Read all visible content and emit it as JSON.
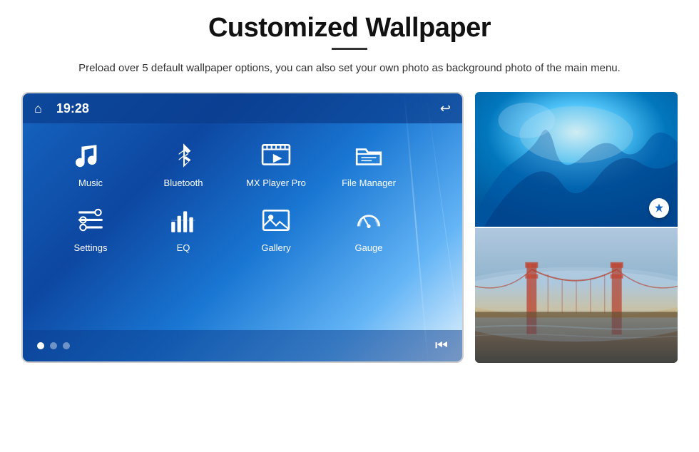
{
  "page": {
    "title": "Customized Wallpaper",
    "subtitle": "Preload over 5 default wallpaper options, you can also set your own photo as background photo of the main menu."
  },
  "device": {
    "time": "19:28",
    "dots": [
      {
        "active": true
      },
      {
        "active": false
      },
      {
        "active": false
      }
    ],
    "apps_row1": [
      {
        "label": "Music",
        "icon": "music"
      },
      {
        "label": "Bluetooth",
        "icon": "bluetooth"
      },
      {
        "label": "MX Player Pro",
        "icon": "video"
      },
      {
        "label": "File Manager",
        "icon": "folder"
      }
    ],
    "apps_row2": [
      {
        "label": "Settings",
        "icon": "settings"
      },
      {
        "label": "EQ",
        "icon": "eq"
      },
      {
        "label": "Gallery",
        "icon": "gallery"
      },
      {
        "label": "Gauge",
        "icon": "gauge"
      }
    ]
  },
  "images": {
    "top_alt": "Ice cave wallpaper",
    "bottom_alt": "Golden Gate Bridge wallpaper"
  },
  "icons": {
    "home": "⌂",
    "back": "↩",
    "skip_back": "⏮"
  }
}
